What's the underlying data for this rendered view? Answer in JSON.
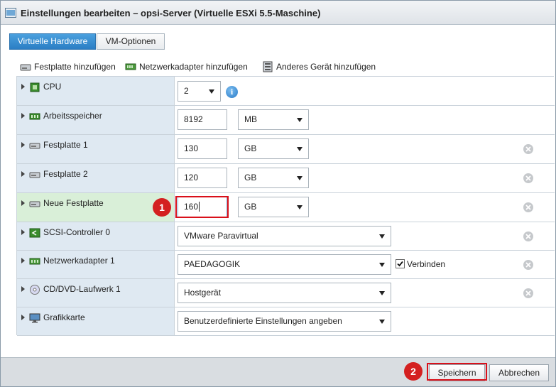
{
  "window": {
    "title": "Einstellungen bearbeiten – opsi-Server (Virtuelle ESXi 5.5-Maschine)"
  },
  "tabs": [
    {
      "label": "Virtuelle Hardware",
      "active": true
    },
    {
      "label": "VM-Optionen",
      "active": false
    }
  ],
  "actions": [
    {
      "label": "Festplatte hinzufügen",
      "icon": "hard-disk-icon"
    },
    {
      "label": "Netzwerkadapter hinzufügen",
      "icon": "network-card-icon"
    },
    {
      "label": "Anderes Gerät hinzufügen",
      "icon": "device-icon"
    }
  ],
  "devices": {
    "cpu": {
      "label": "CPU",
      "value": "2"
    },
    "memory": {
      "label": "Arbeitsspeicher",
      "value": "8192",
      "unit": "MB"
    },
    "disk1": {
      "label": "Festplatte 1",
      "value": "130",
      "unit": "GB"
    },
    "disk2": {
      "label": "Festplatte 2",
      "value": "120",
      "unit": "GB"
    },
    "newdisk": {
      "label": "Neue Festplatte",
      "value": "160",
      "unit": "GB"
    },
    "scsi": {
      "label": "SCSI-Controller 0",
      "value": "VMware Paravirtual"
    },
    "net": {
      "label": "Netzwerkadapter 1",
      "value": "PAEDAGOGIK",
      "connect_label": "Verbinden",
      "connected": true
    },
    "cdrom": {
      "label": "CD/DVD-Laufwerk 1",
      "value": "Hostgerät"
    },
    "video": {
      "label": "Grafikkarte",
      "value": "Benutzerdefinierte Einstellungen angeben"
    }
  },
  "annotations": {
    "step1": "1",
    "step2": "2"
  },
  "footer": {
    "save_label": "Speichern",
    "cancel_label": "Abbrechen"
  },
  "colors": {
    "accent": "#2b7ec4",
    "highlight": "#d9101a",
    "selected_row": "#d9efd8"
  }
}
